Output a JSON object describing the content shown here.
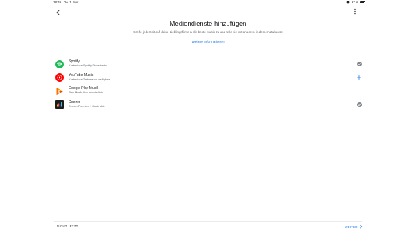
{
  "status_bar": {
    "time": "18:46",
    "date": "Do. 1. Nov.",
    "battery": "97 %"
  },
  "header": {
    "title": "Mediendienste hinzufügen",
    "subtitle": "Greife jederzeit auf deine Lieblingsfilme & die beste Musik zu und teile sie mit anderen in deinem Zuhause",
    "more_info_link": "Weitere Informationen"
  },
  "services": [
    {
      "name": "Spotify",
      "status": "Kostenlose Spotify-Dienst aktiv",
      "logo": "spotify-logo",
      "action": "checkmark-icon",
      "brand_color": "#1db954"
    },
    {
      "name": "YouTube Music",
      "status": "Kostenlose Testversion verfügbar",
      "logo": "youtube-music-logo",
      "action": "add-icon",
      "brand_color": "#ff0000"
    },
    {
      "name": "Google Play Musik",
      "status": "Play Musik-Abo erforderlich",
      "logo": "google-play-music-logo",
      "action": "",
      "brand_color": "#ff6f00"
    },
    {
      "name": "Deezer",
      "status": "Deezer Premium+ Konto aktiv",
      "logo": "deezer-logo",
      "action": "checkmark-icon",
      "brand_color": "#000000"
    }
  ],
  "footer": {
    "skip_label": "NICHT JETZT",
    "next_label": "WEITER"
  },
  "colors": {
    "accent": "#1a73e8",
    "text_primary": "#202124",
    "text_secondary": "#5f6368",
    "check_grey": "#80868b"
  }
}
